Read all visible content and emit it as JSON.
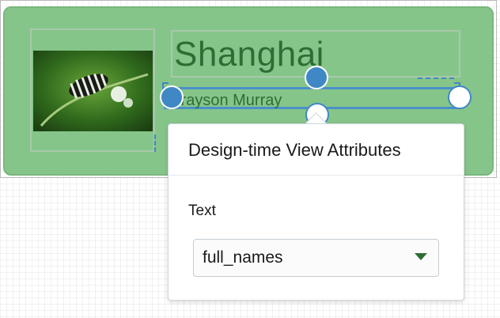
{
  "preview": {
    "city": "Shanghai",
    "name": "Grayson Murray"
  },
  "popup": {
    "title": "Design-time View Attributes",
    "field_label": "Text",
    "selected_value": "full_names"
  },
  "colors": {
    "card_bg": "#86c58a",
    "text_green": "#2f6d35",
    "handle_blue": "#3f88c5",
    "arrow_green": "#2f6d35"
  }
}
